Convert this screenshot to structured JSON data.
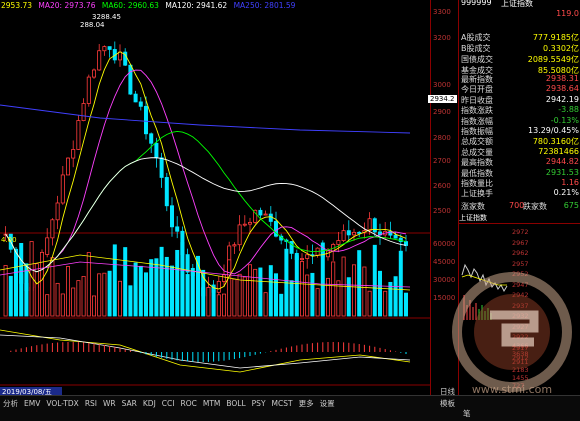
{
  "ma_legend": [
    {
      "label": "2953.73",
      "color": "#ffff00"
    },
    {
      "label": "MA20: 2973.76",
      "color": "#ff40ff"
    },
    {
      "label": "MA60: 2960.63",
      "color": "#00ff00"
    },
    {
      "label": "MA120: 2941.62",
      "color": "#ffffff"
    },
    {
      "label": "MA250: 2801.59",
      "color": "#4040ff"
    }
  ],
  "price_axis": [
    "3300",
    "3200",
    "3000",
    "2900",
    "2800",
    "2700",
    "2600",
    "2500"
  ],
  "price_labels": {
    "high": "3288.45",
    "second": "288.04",
    "current": "2934.2"
  },
  "volume_axis": [
    "60000",
    "45000",
    "30000",
    "15000"
  ],
  "volume_legend": "4.00",
  "date_label": "2019/03/08/五",
  "tabs": [
    "分析",
    "EMV",
    "VOL-TDX",
    "RSI",
    "WR",
    "SAR",
    "KDJ",
    "CCI",
    "ROC",
    "MTM",
    "BOLL",
    "PSY",
    "MCST",
    "更多",
    "设置"
  ],
  "bottom_right": [
    "模板",
    "日线",
    "笔"
  ],
  "right_header": {
    "code": "999999",
    "name": "上证指数",
    "value": "119.0"
  },
  "trade_rows": [
    {
      "k": "A股成交",
      "v": "777.9185亿",
      "c": "yellow"
    },
    {
      "k": "B股成交",
      "v": "0.3302亿",
      "c": "yellow"
    },
    {
      "k": "国债成交",
      "v": "2089.5549亿",
      "c": "yellow"
    },
    {
      "k": "基金成交",
      "v": "85.5080亿",
      "c": "yellow"
    }
  ],
  "index_rows": [
    {
      "k": "最新指数",
      "v": "2938.31",
      "c": "red"
    },
    {
      "k": "今日开盘",
      "v": "2938.64",
      "c": "red"
    },
    {
      "k": "昨日收盘",
      "v": "2942.19",
      "c": "white"
    },
    {
      "k": "指数涨跌",
      "v": "-3.88",
      "c": "green"
    },
    {
      "k": "指数涨幅",
      "v": "-0.13%",
      "c": "green"
    },
    {
      "k": "指数振幅",
      "v": "13.29/0.45%",
      "c": "white"
    },
    {
      "k": "总成交额",
      "v": "780.3160亿",
      "c": "yellow"
    },
    {
      "k": "总成交量",
      "v": "72381466",
      "c": "yellow"
    },
    {
      "k": "最高指数",
      "v": "2944.82",
      "c": "red"
    },
    {
      "k": "最低指数",
      "v": "2931.53",
      "c": "green"
    },
    {
      "k": "指数量比",
      "v": "1.16",
      "c": "red"
    },
    {
      "k": "上证换手",
      "v": "0.21%",
      "c": "white"
    }
  ],
  "updown": {
    "up_label": "涨家数",
    "up": "700",
    "down_label": "跌家数",
    "down": "675"
  },
  "mini_title": "上证指数",
  "mini_ticks": [
    "2972",
    "2967",
    "2962",
    "2957",
    "2952",
    "2947",
    "2942",
    "2937",
    "2932",
    "2927",
    "2922",
    "2917",
    "2912"
  ],
  "mini_vol": [
    "4366",
    "3638",
    "2911",
    "2183",
    "1455",
    "727"
  ],
  "watermark": "www.stmi.com"
}
